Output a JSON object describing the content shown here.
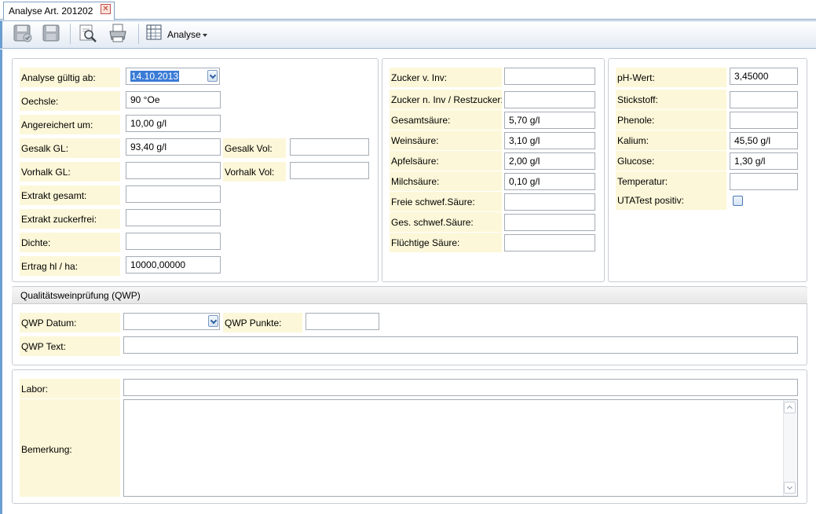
{
  "tab": {
    "title": "Analyse Art. 201202",
    "close": "✕"
  },
  "toolbar": {
    "analyse_label": "Analyse"
  },
  "col1": {
    "gueltig_label": "Analyse gültig ab:",
    "gueltig_value": "14.10.2013",
    "oechsle_label": "Oechsle:",
    "oechsle_value": "90 °Oe",
    "angereichert_label": "Angereichert um:",
    "angereichert_value": "10,00 g/l",
    "gesalk_gl_label": "Gesalk GL:",
    "gesalk_gl_value": "93,40 g/l",
    "gesalk_vol_label": "Gesalk Vol:",
    "gesalk_vol_value": "",
    "vorhalk_gl_label": "Vorhalk GL:",
    "vorhalk_gl_value": "",
    "vorhalk_vol_label": "Vorhalk Vol:",
    "vorhalk_vol_value": "",
    "extrakt_gesamt_label": "Extrakt gesamt:",
    "extrakt_gesamt_value": "",
    "extrakt_zuckerfrei_label": "Extrakt zuckerfrei:",
    "extrakt_zuckerfrei_value": "",
    "dichte_label": "Dichte:",
    "dichte_value": "",
    "ertrag_label": "Ertrag hl / ha:",
    "ertrag_value": "10000,00000"
  },
  "col2": {
    "zucker_v_label": "Zucker v. Inv:",
    "zucker_v_value": "",
    "zucker_n_label": "Zucker n. Inv / Restzucker:",
    "zucker_n_value": "",
    "gesamtsaeure_label": "Gesamtsäure:",
    "gesamtsaeure_value": "5,70 g/l",
    "weinsaeure_label": "Weinsäure:",
    "weinsaeure_value": "3,10 g/l",
    "apfelsaeure_label": "Apfelsäure:",
    "apfelsaeure_value": "2,00 g/l",
    "milchsaeure_label": "Milchsäure:",
    "milchsaeure_value": "0,10 g/l",
    "freie_schwef_label": "Freie schwef.Säure:",
    "freie_schwef_value": "",
    "ges_schwef_label": "Ges. schwef.Säure:",
    "ges_schwef_value": "",
    "fluechtige_label": "Flüchtige Säure:",
    "fluechtige_value": ""
  },
  "col3": {
    "ph_label": "pH-Wert:",
    "ph_value": "3,45000",
    "stickstoff_label": "Stickstoff:",
    "stickstoff_value": "",
    "phenole_label": "Phenole:",
    "phenole_value": "",
    "kalium_label": "Kalium:",
    "kalium_value": "45,50 g/l",
    "glucose_label": "Glucose:",
    "glucose_value": "1,30 g/l",
    "temperatur_label": "Temperatur:",
    "temperatur_value": "",
    "uta_label": "UTATest positiv:"
  },
  "qwp": {
    "header": "Qualitätsweinprüfung (QWP)",
    "datum_label": "QWP Datum:",
    "datum_value": "",
    "punkte_label": "QWP Punkte:",
    "punkte_value": "",
    "text_label": "QWP Text:",
    "text_value": ""
  },
  "bottom": {
    "labor_label": "Labor:",
    "labor_value": "",
    "bemerkung_label": "Bemerkung:",
    "bemerkung_value": ""
  }
}
